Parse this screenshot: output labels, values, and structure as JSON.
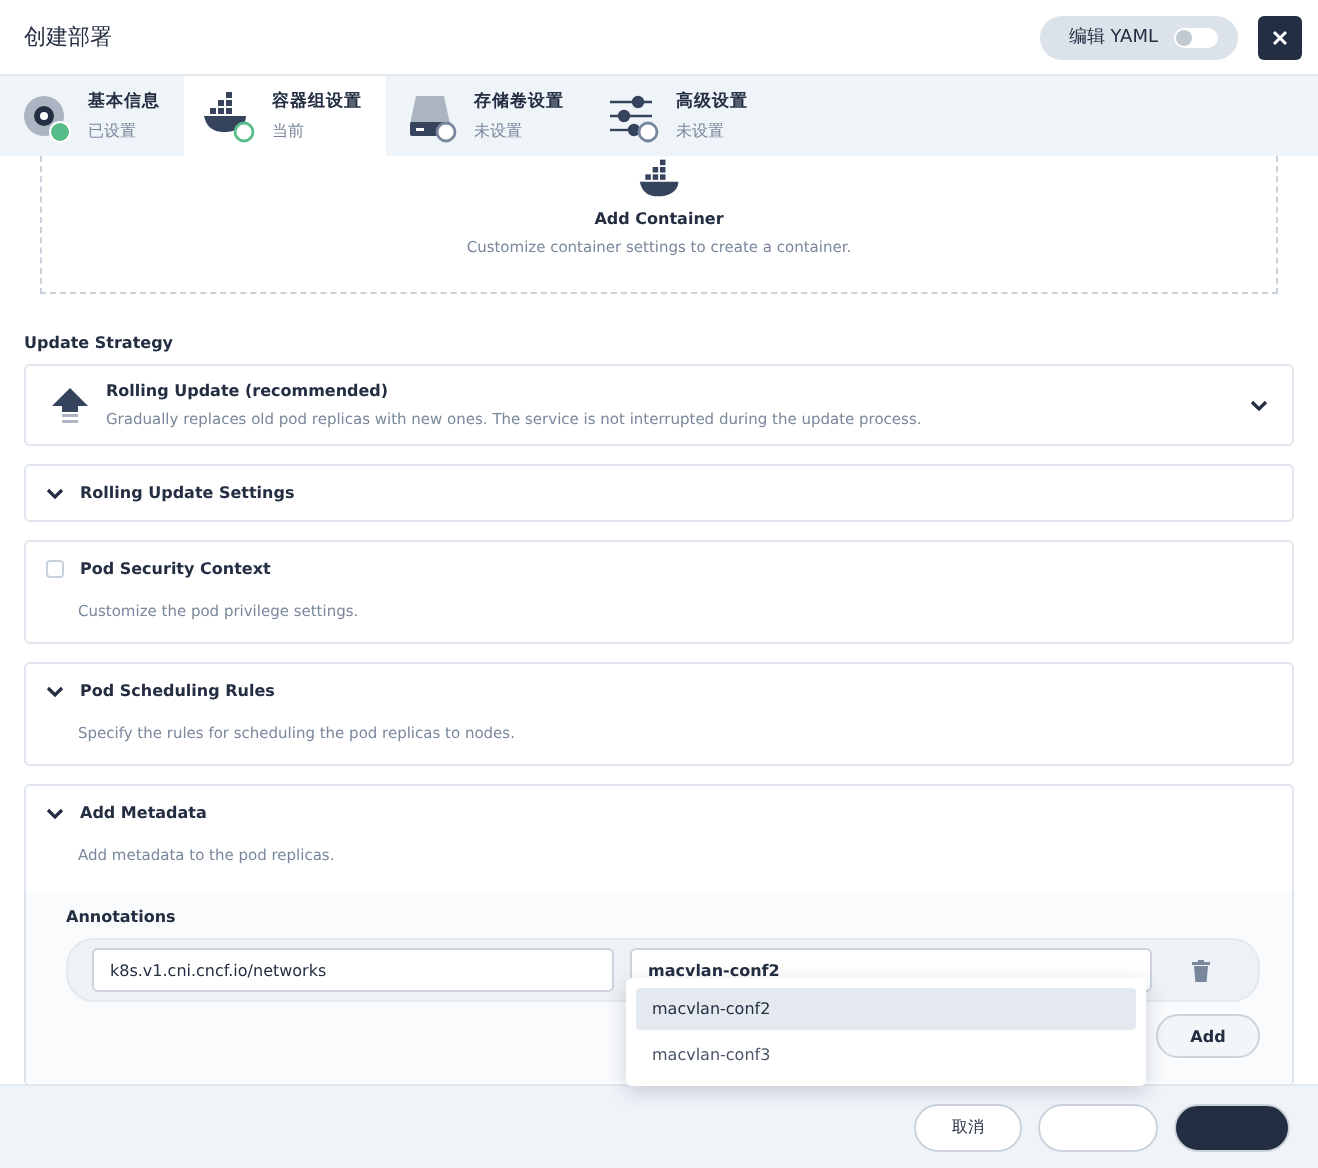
{
  "dialog": {
    "title": "创建部署",
    "yaml_toggle": {
      "label": "编辑 YAML",
      "on": false
    }
  },
  "steps": [
    {
      "kind": "disk",
      "title": "基本信息",
      "status_text": "已设置",
      "completed": true,
      "selected": false
    },
    {
      "kind": "docker",
      "title": "容器组设置",
      "status_text": "当前",
      "completed": false,
      "selected": true
    },
    {
      "kind": "storage",
      "title": "存储卷设置",
      "status_text": "未设置",
      "completed": false,
      "selected": false
    },
    {
      "kind": "sliders",
      "title": "高级设置",
      "status_text": "未设置",
      "completed": false,
      "selected": false
    }
  ],
  "add_container": {
    "title": "Add Container",
    "description": "Customize container settings to create a container."
  },
  "update_strategy": {
    "label": "Update Strategy",
    "title": "Rolling Update (recommended)",
    "description": "Gradually replaces old pod replicas with new ones. The service is not interrupted during the update process."
  },
  "sections": [
    {
      "kind": "collapsible",
      "title": "Rolling Update Settings"
    },
    {
      "kind": "checkbox",
      "title": "Pod Security Context",
      "description": "Customize the pod privilege settings.",
      "checked": false
    },
    {
      "kind": "collapsible",
      "title": "Pod Scheduling Rules",
      "description": "Specify the rules for scheduling the pod replicas to nodes."
    }
  ],
  "metadata": {
    "title": "Add Metadata",
    "description": "Add metadata to the pod replicas.",
    "annotations_label": "Annotations",
    "annotations": [
      {
        "key": "k8s.v1.cni.cncf.io/networks",
        "value": "macvlan-conf2"
      }
    ],
    "add_button": "Add",
    "dropdown": [
      {
        "label": "macvlan-conf2",
        "selected": true
      },
      {
        "label": "macvlan-conf3",
        "selected": false
      }
    ]
  },
  "footer": {
    "cancel": "取消"
  }
}
